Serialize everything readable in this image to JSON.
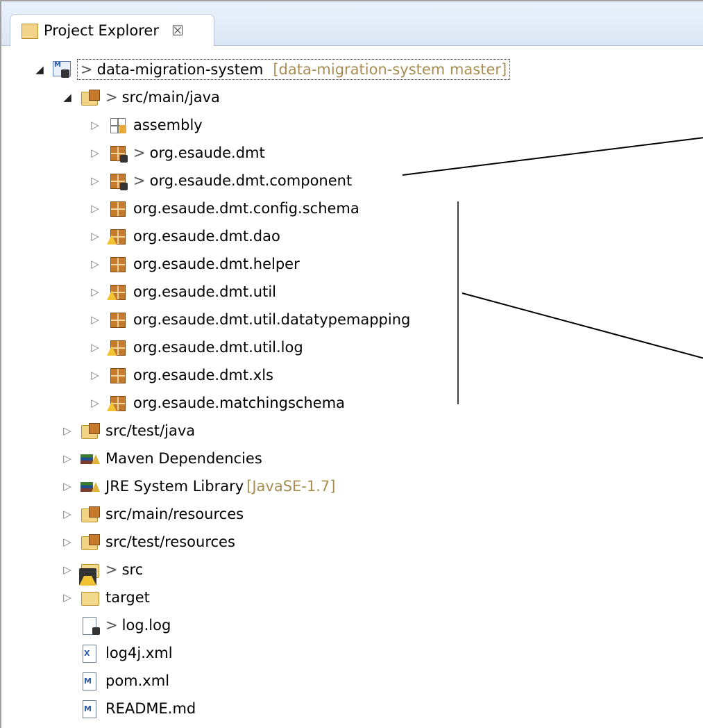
{
  "view": {
    "tab_title": "Project Explorer",
    "tab_close": "☒"
  },
  "tree": [
    {
      "label": "data-migration-system",
      "prefix": ">",
      "decoration": "[data-migration-system master]",
      "icon": "project-icon",
      "twisty": "expanded"
    },
    {
      "label": "src/main/java",
      "prefix": ">",
      "icon": "source-folder-warning-icon",
      "twisty": "expanded"
    },
    {
      "label": "assembly",
      "icon": "empty-package-icon",
      "twisty": "collapsed"
    },
    {
      "label": "org.esaude.dmt",
      "prefix": ">",
      "icon": "package-dirty-icon",
      "twisty": "collapsed"
    },
    {
      "label": "org.esaude.dmt.component",
      "prefix": ">",
      "icon": "package-dirty-icon",
      "twisty": "collapsed"
    },
    {
      "label": "org.esaude.dmt.config.schema",
      "icon": "package-icon",
      "twisty": "collapsed"
    },
    {
      "label": "org.esaude.dmt.dao",
      "icon": "package-warning-icon",
      "twisty": "collapsed"
    },
    {
      "label": "org.esaude.dmt.helper",
      "icon": "package-icon",
      "twisty": "collapsed"
    },
    {
      "label": "org.esaude.dmt.util",
      "icon": "package-warning-icon",
      "twisty": "collapsed"
    },
    {
      "label": "org.esaude.dmt.util.datatypemapping",
      "icon": "package-icon",
      "twisty": "collapsed"
    },
    {
      "label": "org.esaude.dmt.util.log",
      "icon": "package-warning-icon",
      "twisty": "collapsed"
    },
    {
      "label": "org.esaude.dmt.xls",
      "icon": "package-icon",
      "twisty": "collapsed"
    },
    {
      "label": "org.esaude.matchingschema",
      "icon": "package-warning-icon",
      "twisty": "collapsed"
    },
    {
      "label": "src/test/java",
      "icon": "source-folder-warning-icon",
      "twisty": "collapsed"
    },
    {
      "label": "Maven Dependencies",
      "icon": "library-icon",
      "twisty": "collapsed"
    },
    {
      "label": "JRE System Library",
      "decoration": "[JavaSE-1.7]",
      "icon": "library-icon",
      "twisty": "collapsed"
    },
    {
      "label": "src/main/resources",
      "icon": "resource-folder-warning-icon",
      "twisty": "collapsed"
    },
    {
      "label": "src/test/resources",
      "icon": "resource-folder-icon",
      "twisty": "collapsed"
    },
    {
      "label": "src",
      "prefix": ">",
      "icon": "folder-warning-dirty-icon",
      "twisty": "collapsed"
    },
    {
      "label": "target",
      "icon": "folder-icon",
      "twisty": "collapsed"
    },
    {
      "label": "log.log",
      "prefix": ">",
      "icon": "text-file-dirty-icon",
      "twisty": "none"
    },
    {
      "label": "log4j.xml",
      "icon": "xml-file-icon",
      "twisty": "none"
    },
    {
      "label": "pom.xml",
      "icon": "maven-pom-icon",
      "twisty": "none"
    },
    {
      "label": "README.md",
      "icon": "markdown-file-icon",
      "twisty": "none"
    }
  ]
}
